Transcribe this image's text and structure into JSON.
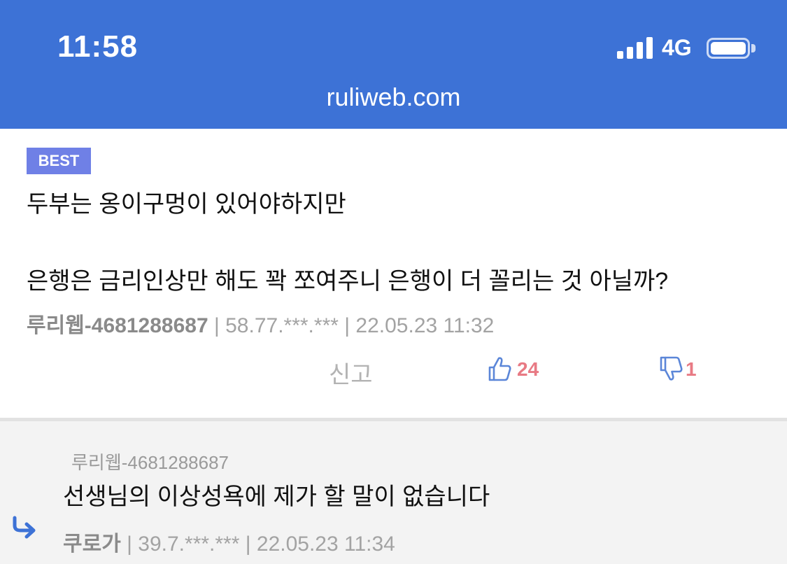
{
  "status_bar": {
    "time": "11:58",
    "network": "4G",
    "url": "ruliweb.com",
    "color": "#3d72d6"
  },
  "comment": {
    "badge": "BEST",
    "line1": "두부는 옹이구멍이 있어야하지만",
    "line2": "은행은 금리인상만 해도 꽉 쪼여주니 은행이 더 꼴리는 것 아닐까?",
    "author": "루리웹-4681288687",
    "ip": "58.77.***.***",
    "date": "22.05.23 11:32",
    "report_label": "신고",
    "likes": "24",
    "dislikes": "1"
  },
  "reply": {
    "reply_to": "루리웹-4681288687",
    "text": "선생님의 이상성욕에 제가 할 말이 없습니다",
    "author": "쿠로가",
    "ip": "39.7.***.***",
    "date": "22.05.23 11:34"
  },
  "icons": [
    "signal-icon",
    "battery-icon",
    "thumbs-up-icon",
    "thumbs-down-icon",
    "reply-arrow-icon"
  ]
}
